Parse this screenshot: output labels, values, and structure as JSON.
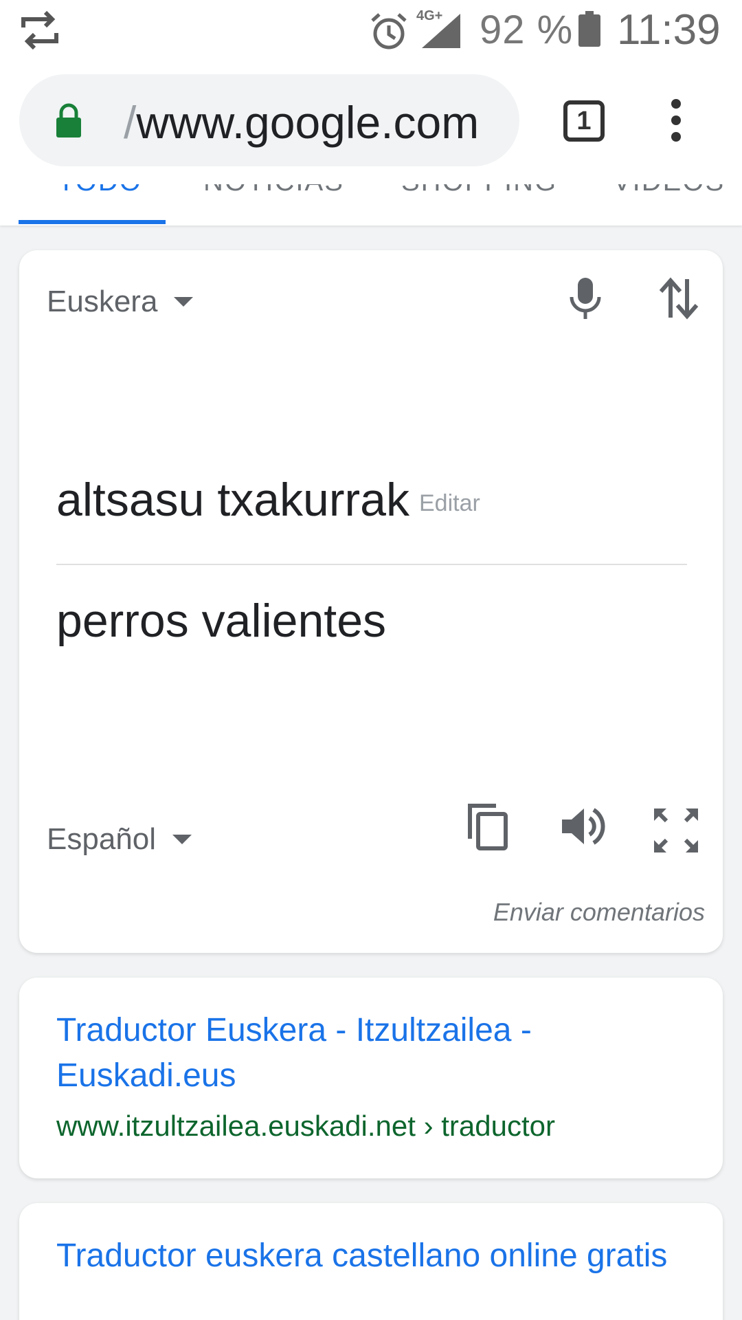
{
  "status_bar": {
    "network": "4G+",
    "battery_percent": "92 %",
    "time": "11:39",
    "icons": [
      "sync-icon",
      "alarm-icon",
      "signal-icon",
      "battery-icon"
    ]
  },
  "address_bar": {
    "url_prefix": "/",
    "url_host": "www.google.com",
    "tab_count": "1",
    "lock_color": "#188038"
  },
  "search_tabs": {
    "items": [
      "TODO",
      "NOTICIAS",
      "SHOPPING",
      "VÍDEOS"
    ],
    "active_index": 0
  },
  "translate": {
    "source_language": "Euskera",
    "source_text": "altsasu txakurrak",
    "edit_label": "Editar",
    "translated_text": "perros valientes",
    "target_language": "Español",
    "feedback_link": "Enviar comentarios"
  },
  "results": [
    {
      "title": "Traductor Euskera - Itzultzailea - Euskadi.eus",
      "url": "www.itzultzailea.euskadi.net › traductor"
    },
    {
      "title": "Traductor euskera castellano online gratis"
    }
  ],
  "colors": {
    "accent": "#1a73e8",
    "result_url": "#0d652d",
    "text_primary": "#202124",
    "text_secondary": "#5f6368"
  }
}
